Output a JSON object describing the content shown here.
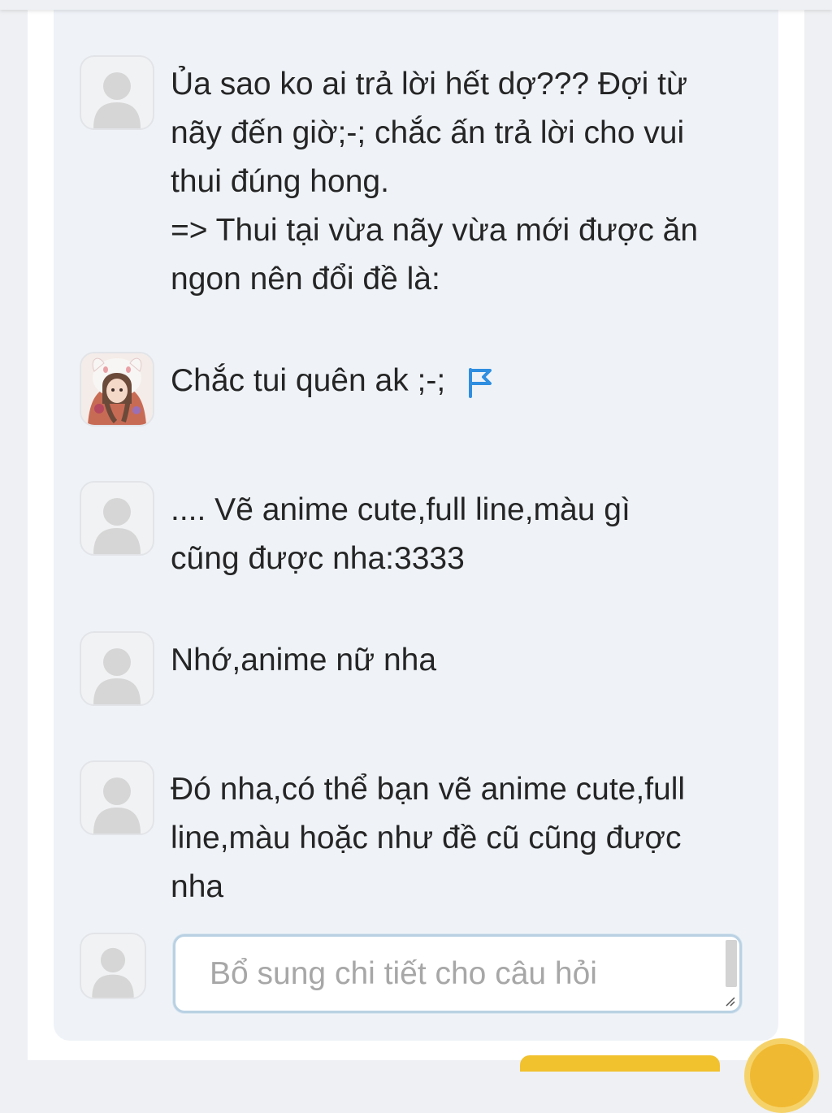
{
  "comments": [
    {
      "text": "Ủa sao ko ai trả lời hết dợ??? Đợi từ\nnãy đến giờ;-; chắc ấn trả lời cho vui\nthui đúng hong.\n=> Thui tại vừa nãy vừa mới được ăn\nngon nên đổi đề là:",
      "avatar": "default-user-icon"
    },
    {
      "text": "Chắc tui quên ak ;-;",
      "avatar": "anime-girl-avatar",
      "report_icon": "flag-icon"
    },
    {
      "text": ".... Vẽ anime cute,full line,màu gì\ncũng được nha:3333",
      "avatar": "default-user-icon"
    },
    {
      "text": "Nhớ,anime nữ nha",
      "avatar": "default-user-icon"
    },
    {
      "text": "Đó nha,có thể bạn vẽ anime cute,full\nline,màu hoặc như đề cũ cũng được\nnha",
      "avatar": "default-user-icon"
    }
  ],
  "reply": {
    "placeholder": "Bổ sung chi tiết cho câu hỏi",
    "value": "",
    "avatar": "default-user-icon"
  },
  "colors": {
    "panel_background": "#eff3f8",
    "text": "#252525",
    "flag": "#2f8ee0",
    "input_border": "#b9d1e3",
    "accent_yellow": "#f2c12e"
  }
}
